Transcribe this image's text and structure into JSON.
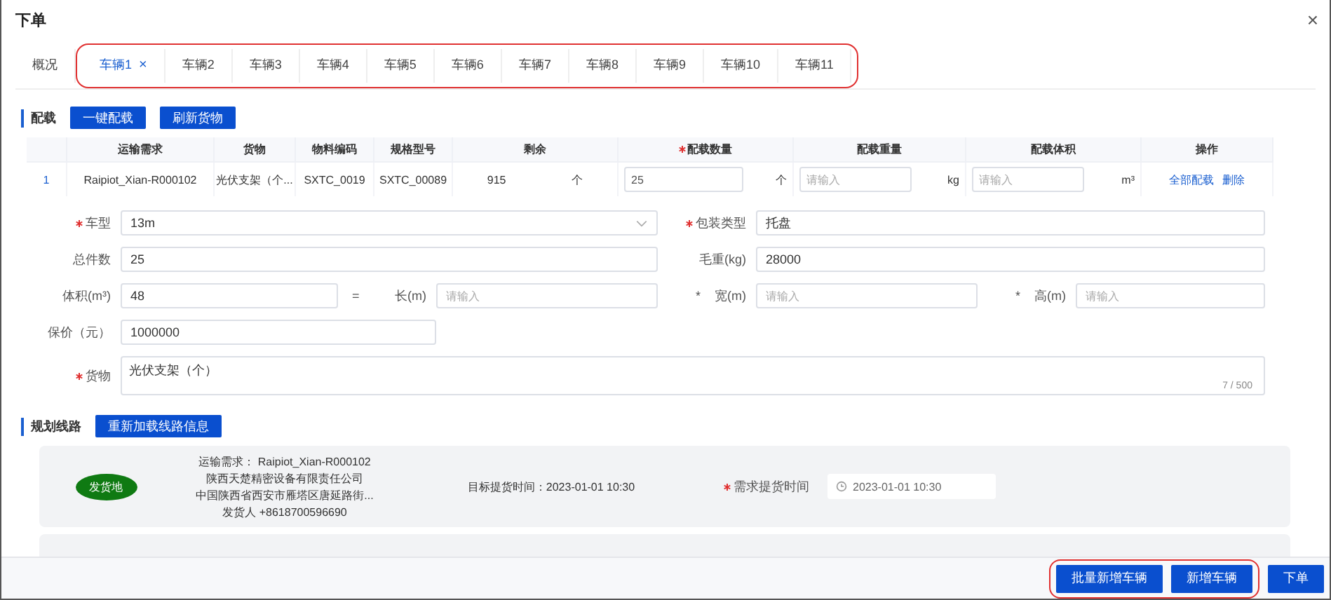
{
  "dialog": {
    "title": "下单",
    "close": "×"
  },
  "tabs": [
    {
      "label": "概况",
      "selected": false,
      "closable": false
    },
    {
      "label": "车辆1",
      "selected": true,
      "closable": true,
      "close": "×"
    },
    {
      "label": "车辆2",
      "selected": false,
      "closable": false
    },
    {
      "label": "车辆3",
      "selected": false,
      "closable": false
    },
    {
      "label": "车辆4",
      "selected": false,
      "closable": false
    },
    {
      "label": "车辆5",
      "selected": false,
      "closable": false
    },
    {
      "label": "车辆6",
      "selected": false,
      "closable": false
    },
    {
      "label": "车辆7",
      "selected": false,
      "closable": false
    },
    {
      "label": "车辆8",
      "selected": false,
      "closable": false
    },
    {
      "label": "车辆9",
      "selected": false,
      "closable": false
    },
    {
      "label": "车辆10",
      "selected": false,
      "closable": false
    },
    {
      "label": "车辆11",
      "selected": false,
      "closable": false
    }
  ],
  "loading": {
    "title": "配载",
    "buttons": [
      "一键配载",
      "刷新货物"
    ]
  },
  "table": {
    "columns": [
      {
        "required": false
      },
      {
        "label": "运输需求",
        "required": false
      },
      {
        "label": "货物",
        "required": false
      },
      {
        "label": "物料编码",
        "required": false
      },
      {
        "label": "规格型号",
        "required": false
      },
      {
        "label": "剩余",
        "required": false
      },
      {
        "label": "配载数量",
        "required": true
      },
      {
        "label": "配载重量",
        "required": false
      },
      {
        "label": "配载体积",
        "required": false
      },
      {
        "label": "操作",
        "required": false
      }
    ],
    "rows": [
      {
        "index": "1",
        "demand": "Raipiot_Xian-R000102",
        "goods": "光伏支架（个...",
        "material_code": "SXTC_0019",
        "spec": "SXTC_00089",
        "remaining": "915",
        "remaining_unit": "个",
        "quantity": "25",
        "quantity_unit": "个",
        "weight_placeholder": "请输入",
        "weight_unit": "kg",
        "volume_placeholder": "请输入",
        "volume_unit": "m³",
        "actions": [
          "全部配载",
          "删除"
        ]
      }
    ]
  },
  "form": {
    "vehicle_type": {
      "label": "车型",
      "required": true,
      "value": "13m"
    },
    "packaging": {
      "label": "包装类型",
      "required": true,
      "value": "托盘"
    },
    "total_pieces": {
      "label": "总件数",
      "required": false,
      "value": "25"
    },
    "gross_weight": {
      "label": "毛重(kg)",
      "required": false,
      "value": "28000"
    },
    "volume": {
      "label": "体积(m³)",
      "required": false,
      "value": "48"
    },
    "equals": "=",
    "length": {
      "label": "长(m)",
      "placeholder": "请输入"
    },
    "width_operator": "*",
    "width": {
      "label": "宽(m)",
      "placeholder": "请输入"
    },
    "height_operator": "*",
    "height": {
      "label": "高(m)",
      "placeholder": "请输入"
    },
    "insured_value": {
      "label": "保价（元）",
      "required": false,
      "value": "1000000"
    },
    "goods": {
      "label": "货物",
      "required": true,
      "value": "光伏支架（个）",
      "counter": "7 / 500"
    }
  },
  "route": {
    "title": "规划线路",
    "button": "重新加载线路信息",
    "stops": [
      {
        "badge": "发货地",
        "color": "#0f7a12",
        "demand_label": "运输需求：",
        "demand": "Raipiot_Xian-R000102",
        "company": "陕西天楚精密设备有限责任公司",
        "address": "中国陕西省西安市雁塔区唐延路街...",
        "contact_label": "发货人",
        "contact": "+8618700596690",
        "target_time": "目标提货时间：2023-01-01 10:30",
        "time_label": "需求提货时间",
        "time_required": true,
        "time_value": "2023-01-01 10:30"
      }
    ]
  },
  "footer": {
    "outlined_group": {
      "outlined": true,
      "buttons": [
        "批量新增车辆",
        "新增车辆"
      ]
    },
    "buttons": [
      "下单"
    ]
  }
}
